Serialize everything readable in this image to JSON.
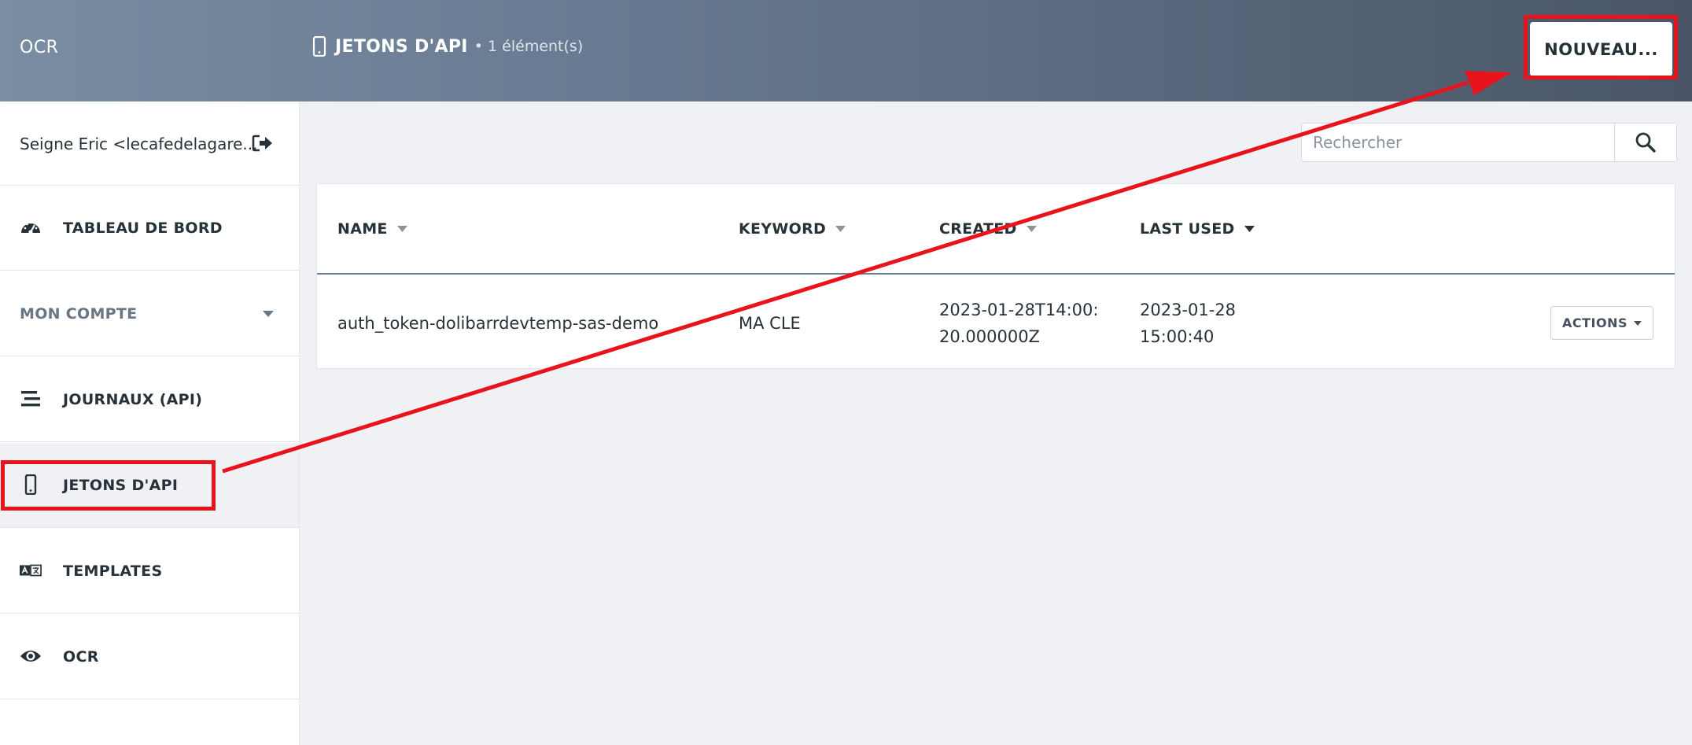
{
  "header": {
    "brand": "OCR",
    "page_title": "JETONS D'API",
    "item_count": "• 1 élément(s)",
    "new_button": "NOUVEAU..."
  },
  "sidebar": {
    "user": "Seigne Eric <lecafedelagare...",
    "items": [
      {
        "label": "TABLEAU DE BORD",
        "icon": "dashboard-icon"
      },
      {
        "label": "MON COMPTE",
        "icon": "chevron-down-icon"
      },
      {
        "label": "JOURNAUX (API)",
        "icon": "list-icon"
      },
      {
        "label": "JETONS D'API",
        "icon": "phone-icon",
        "active": true
      },
      {
        "label": "TEMPLATES",
        "icon": "translate-icon"
      },
      {
        "label": "OCR",
        "icon": "eye-icon"
      }
    ]
  },
  "search": {
    "placeholder": "Rechercher"
  },
  "table": {
    "columns": [
      "NAME",
      "KEYWORD",
      "CREATED",
      "LAST USED"
    ],
    "rows": [
      {
        "name": "auth_token-dolibarrdevtemp-sas-demo",
        "keyword": "MA CLE",
        "created_line1": "2023-01-28T14:00:",
        "created_line2": "20.000000Z",
        "last_used_line1": "2023-01-28",
        "last_used_line2": "15:00:40",
        "actions": "ACTIONS"
      }
    ]
  },
  "colors": {
    "annotation": "#e8141b",
    "header_start": "#7b8da3",
    "header_end": "#4a5667"
  }
}
